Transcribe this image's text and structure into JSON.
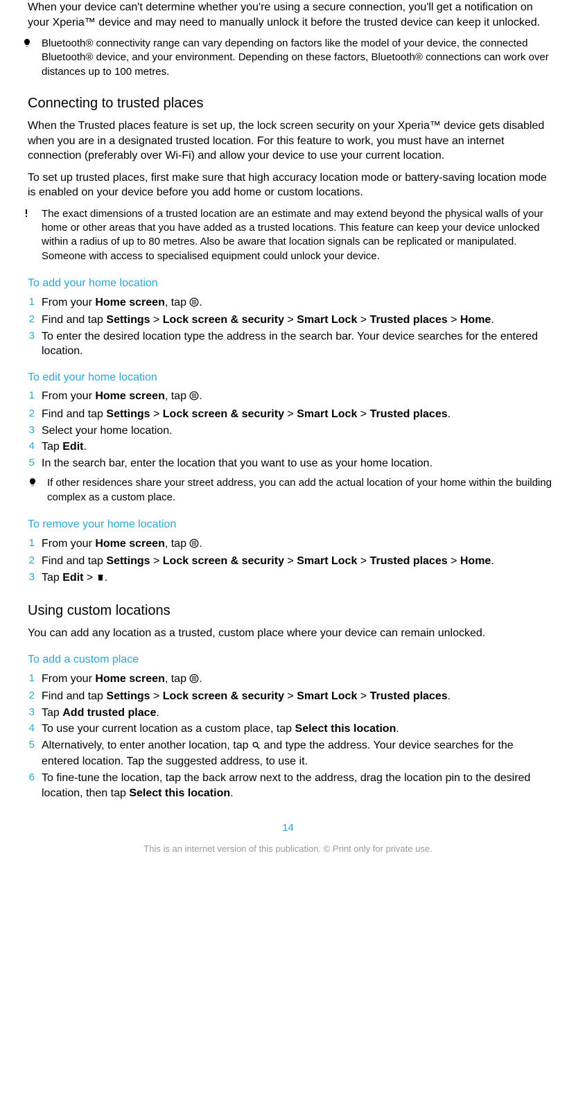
{
  "intro_para": "When your device can't determine whether you're using a secure connection, you'll get a notification on your Xperia™ device and may need to manually unlock it before the trusted device can keep it unlocked.",
  "bt_note": "Bluetooth® connectivity range can vary depending on factors like the model of your device, the connected Bluetooth® device, and your environment. Depending on these factors, Bluetooth® connections can work over distances up to 100 metres.",
  "sec1_title": "Connecting to trusted places",
  "sec1_p1": "When the Trusted places feature is set up, the lock screen security on your Xperia™ device gets disabled when you are in a designated trusted location. For this feature to work, you must have an internet connection (preferably over Wi-Fi) and allow your device to use your current location.",
  "sec1_p2": "To set up trusted places, first make sure that high accuracy location mode or battery-saving location mode is enabled on your device before you add home or custom locations.",
  "sec1_warn": "The exact dimensions of a trusted location are an estimate and may extend beyond the physical walls of your home or other areas that you have added as a trusted locations. This feature can keep your device unlocked within a radius of up to 80 metres. Also be aware that location signals can be replicated or manipulated. Someone with access to specialised equipment could unlock your device.",
  "add_home_title": "To add your home location",
  "labels": {
    "from_your": "From your ",
    "home_screen": "Home screen",
    "tap": ", tap ",
    "find_tap": "Find and tap ",
    "settings": "Settings",
    "lock_sec": "Lock screen & security",
    "smart_lock": "Smart Lock",
    "trusted_places": "Trusted places",
    "home": "Home",
    "edit": "Edit",
    "add_trusted": "Add trusted place",
    "select_loc": "Select this location",
    "gt": " > "
  },
  "add_home_step3": "To enter the desired location type the address in the search bar. Your device searches for the entered location.",
  "edit_home_title": "To edit your home location",
  "edit_home_s3": "Select your home location.",
  "edit_home_s4_pre": "Tap ",
  "edit_home_s5": "In the search bar, enter the location that you want to use as your home location.",
  "edit_home_tip": "If other residences share your street address, you can add the actual location of your home within the building complex as a custom place.",
  "remove_home_title": "To remove your home location",
  "remove_home_s3_pre": "Tap ",
  "sec2_title": "Using custom locations",
  "sec2_p1": "You can add any location as a trusted, custom place where your device can remain unlocked.",
  "add_custom_title": "To add a custom place",
  "add_custom_s3_pre": "Tap ",
  "add_custom_s4_pre": "To use your current location as a custom place, tap ",
  "add_custom_s5_pre": "Alternatively, to enter another location, tap ",
  "add_custom_s5_post": " and type the address. Your device searches for the entered location. Tap the suggested address, to use it.",
  "add_custom_s6_pre": "To fine-tune the location, tap the back arrow next to the address, drag the location pin to the desired location, then tap ",
  "page_number": "14",
  "footer": "This is an internet version of this publication. © Print only for private use."
}
